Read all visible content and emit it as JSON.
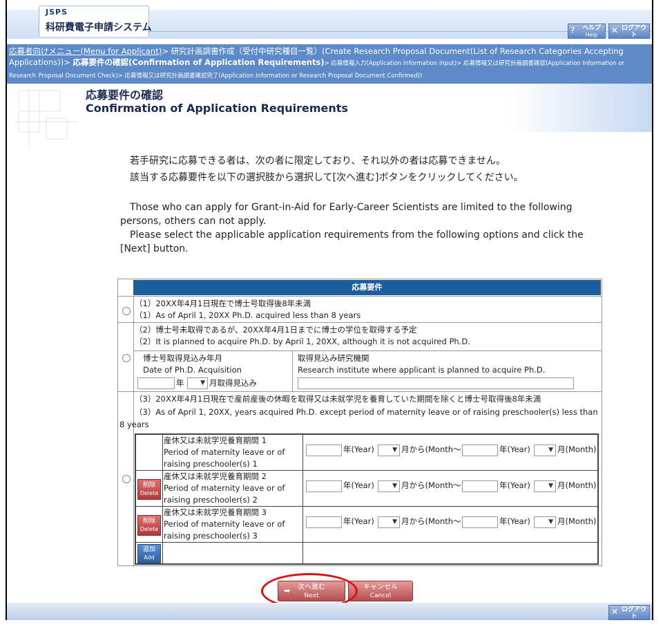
{
  "header": {
    "logo_org": "JSPS",
    "logo_title": "科研費電子申請システム",
    "help_jp": "ヘルプ",
    "help_en": "Help",
    "logout_jp": "ログアウト",
    "logout_en": "Log out"
  },
  "breadcrumb": {
    "link": "応募者向けメニュー(Menu for Applicant)",
    "seg1": "> 研究計画調書作成（受付中研究種目一覧）(Create Research Proposal Document(List of Research Categories Accepting Applications))>",
    "current": "応募要件の確認(Confirmation of Application Requirements)",
    "seg2": "> 応募情報入力(Application Information Input)> 応募情報又は研究計画調書確認(Application Information or Research",
    "seg3": "Proposal Document Check)> 応募情報又は研究計画調書確認完了(Application Information or Research Proposal Document Confirmed))"
  },
  "page": {
    "title_jp": "応募要件の確認",
    "title_en": "Confirmation of Application Requirements",
    "intro_jp_1": "若手研究に応募できる者は、次の者に限定しており、それ以外の者は応募できません。",
    "intro_jp_2": "該当する応募要件を以下の選択肢から選択して[次へ進む]ボタンをクリックしてください。",
    "intro_en_1": "Those who can apply for Grant-in-Aid for Early-Career Scientists are limited to the following persons, others can not apply.",
    "intro_en_2": "Please select the applicable application requirements from the following options and click the [Next] button."
  },
  "requirements": {
    "header": "応募要件",
    "opt1_jp": "（1）20XX年4月1日現在で博士号取得後8年未満",
    "opt1_en": "（1）As of April 1, 20XX Ph.D. acquired less than 8 years",
    "opt2_jp": "（2）博士号未取得であるが、20XX年4月1日までに博士の学位を取得する予定",
    "opt2_en": "（2）It is planned to acquire Ph.D. by April 1, 20XX, although it is not acquired Ph.D.",
    "opt2_date_label_jp": "博士号取得見込み年月",
    "opt2_date_label_en": "Date of Ph.D. Acquisition",
    "opt2_year_unit": "年",
    "opt2_month_unit": "月取得見込み",
    "opt2_inst_label_jp": "取得見込み研究機関",
    "opt2_inst_label_en": "Research institute where applicant is planned to acquire Ph.D.",
    "opt3_jp": "（3）20XX年4月1日現在で産前産後の休暇を取得又は未就学児を養育していた期間を除くと博士号取得後8年未満",
    "opt3_en": "（3）As of April 1, 20XX, years acquired Ph.D. except period of maternity leave or of raising preschooler(s) less than 8 years",
    "periods": [
      {
        "jp": "産休又は未就学児養育期間 1",
        "en": "Period of maternity leave or of raising preschooler(s) 1"
      },
      {
        "jp": "産休又は未就学児養育期間 2",
        "en": "Period of maternity leave or of raising preschooler(s) 2"
      },
      {
        "jp": "産休又は未就学児養育期間 3",
        "en": "Period of maternity leave or of raising preschooler(s) 3"
      }
    ],
    "year_label": "年(Year)",
    "from_month_label": "月から(Month～)",
    "month_label": "月(Month)",
    "delete_jp": "削除",
    "delete_en": "Delete",
    "add_jp": "追加",
    "add_en": "Add"
  },
  "actions": {
    "next_jp": "次へ進む",
    "next_en": "Next",
    "cancel_jp": "キャンセル",
    "cancel_en": "Cancel"
  },
  "colors": {
    "breadcrumb_bg": "#5d8ac9",
    "table_header_bg": "#1c5e9c",
    "button_red": "#b54d4d",
    "highlight_ring": "#e01010"
  }
}
